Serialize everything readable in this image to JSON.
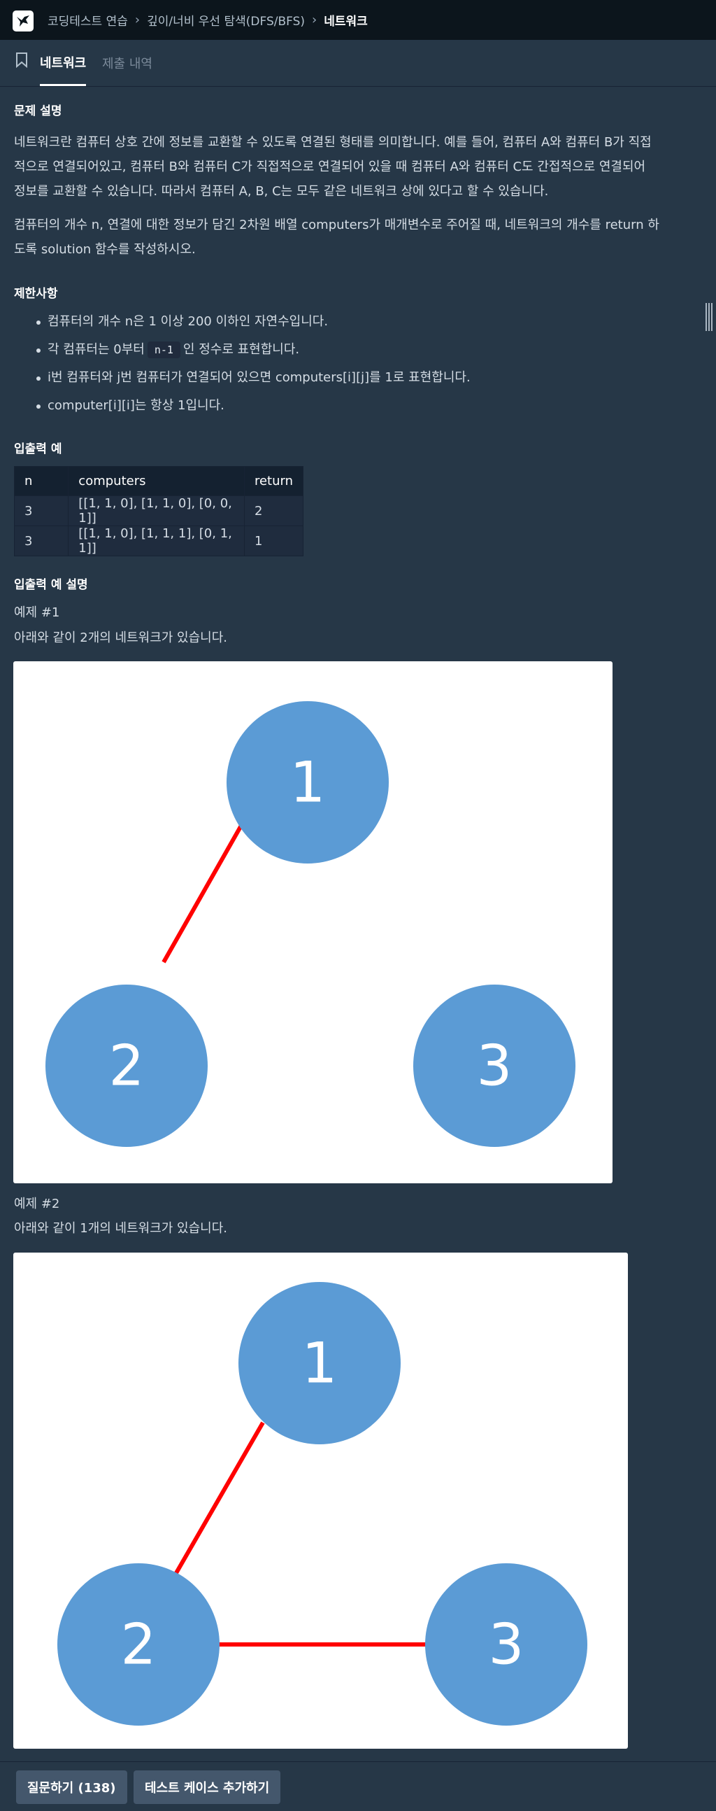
{
  "header": {
    "logo_icon": "programmers-logo-icon",
    "breadcrumbs": [
      "코딩테스트 연습",
      "깊이/너비 우선 탐색(DFS/BFS)",
      "네트워크"
    ]
  },
  "tabs": {
    "icon": "bookmark-icon",
    "active": "네트워크",
    "inactive": "제출 내역"
  },
  "problem": {
    "title": "문제 설명",
    "paragraph1": [
      "네트워크란 컴퓨터 상호 간에 정보를 교환할 수 있도록 연결된 형태를 의미합니다. 예를 들어, 컴퓨터 A와 컴퓨터 B가 직접",
      "적으로 연결되어있고, 컴퓨터 B와 컴퓨터 C가 직접적으로 연결되어 있을 때 컴퓨터 A와 컴퓨터 C도 간접적으로 연결되어",
      "정보를 교환할 수 있습니다. 따라서 컴퓨터 A, B, C는 모두 같은 네트워크 상에 있다고 할 수 있습니다."
    ],
    "paragraph2": [
      "컴퓨터의 개수 n, 연결에 대한 정보가 담긴 2차원 배열 computers가 매개변수로 주어질 때, 네트워크의 개수를 return 하",
      "도록 solution 함수를 작성하시오."
    ]
  },
  "limits": {
    "title": "제한사항",
    "item1": "컴퓨터의 개수 n은 1 이상 200 이하인 자연수입니다.",
    "item2_before": "각 컴퓨터는 0부터",
    "item2_code": "n-1",
    "item2_after": "인 정수로 표현합니다.",
    "item3": "i번 컴퓨터와 j번 컴퓨터가 연결되어 있으면 computers[i][j]를 1로 표현합니다.",
    "item4": "computer[i][i]는 항상 1입니다."
  },
  "io": {
    "title": "입출력 예",
    "headers": [
      "n",
      "computers",
      "return"
    ],
    "rows": [
      [
        "3",
        "[[1, 1, 0], [1, 1, 0], [0, 0, 1]]",
        "2"
      ],
      [
        "3",
        "[[1, 1, 0], [1, 1, 1], [0, 1, 1]]",
        "1"
      ]
    ]
  },
  "explanation": {
    "title": "입출력 예 설명",
    "example1_title": "예제 #1",
    "example1_desc": "아래와 같이 2개의 네트워크가 있습니다.",
    "example2_title": "예제 #2",
    "example2_desc": "아래와 같이 1개의 네트워크가 있습니다."
  },
  "diagram1": {
    "nodes": [
      "1",
      "2",
      "3"
    ],
    "edges": [
      [
        "1",
        "2"
      ]
    ]
  },
  "diagram2": {
    "nodes": [
      "1",
      "2",
      "3"
    ],
    "edges": [
      [
        "1",
        "2"
      ],
      [
        "2",
        "3"
      ]
    ]
  },
  "colors": {
    "node": "#5b9bd5",
    "edge": "#ff0000",
    "background": "#263747"
  },
  "footer": {
    "question_button": "질문하기 (138)",
    "add_testcase_button": "테스트 케이스 추가하기"
  }
}
